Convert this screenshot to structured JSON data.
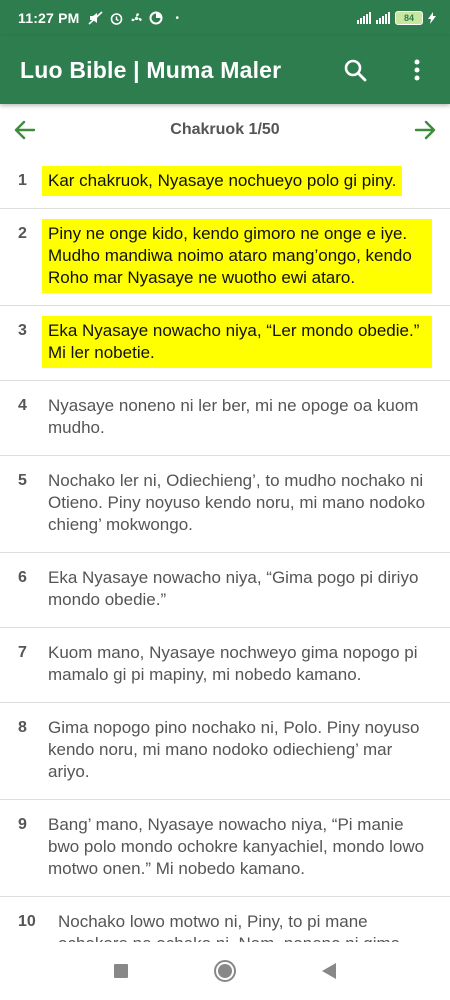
{
  "status_bar": {
    "time": "11:27 PM",
    "battery": "84"
  },
  "app_bar": {
    "title": "Luo Bible | Muma Maler",
    "search_icon": "search-icon",
    "menu_icon": "more-vert-icon",
    "color": "#2e7d4f"
  },
  "chapter_nav": {
    "title": "Chakruok 1/50",
    "prev_icon": "arrow-left-icon",
    "next_icon": "arrow-right-icon"
  },
  "highlight_color": "#ffff00",
  "verses": [
    {
      "num": "1",
      "text": "Kar chakruok, Nyasaye nochueyo polo gi piny.",
      "highlighted": true
    },
    {
      "num": "2",
      "text": "Piny ne onge kido, kendo gimoro ne onge e iye. Mudho mandiwa noimo ataro mang’ongo, kendo Roho mar Nyasaye ne wuotho ewi ataro.",
      "highlighted": true
    },
    {
      "num": "3",
      "text": "Eka Nyasaye nowacho niya, “Ler mondo obedie.” Mi ler nobetie.",
      "highlighted": true
    },
    {
      "num": "4",
      "text": "Nyasaye noneno ni ler ber, mi ne opoge oa kuom mudho.",
      "highlighted": false
    },
    {
      "num": "5",
      "text": "Nochako ler ni, Odiechieng’, to mudho nochako ni Otieno. Piny noyuso kendo noru, mi mano nodoko chieng’ mokwongo.",
      "highlighted": false
    },
    {
      "num": "6",
      "text": "Eka Nyasaye nowacho niya, “Gima pogo pi diriyo mondo obedie.”",
      "highlighted": false
    },
    {
      "num": "7",
      "text": "Kuom mano, Nyasaye nochweyo gima nopogo pi mamalo gi pi mapiny, mi nobedo kamano.",
      "highlighted": false
    },
    {
      "num": "8",
      "text": "Gima nopogo pino nochako ni, Polo. Piny noyuso kendo noru, mi mano nodoko odiechieng’ mar ariyo.",
      "highlighted": false
    },
    {
      "num": "9",
      "text": "Bang’ mano, Nyasaye nowacho niya, “Pi manie bwo polo mondo ochokre kanyachiel, mondo lowo motwo onen.” Mi nobedo kamano.",
      "highlighted": false
    },
    {
      "num": "10",
      "text": "Nochako lowo motwo ni, Piny, to pi mane ochokore ne ochako ni, Nam, noneno ni gima",
      "highlighted": false
    }
  ],
  "system_nav": {
    "recents_icon": "square-recents-icon",
    "home_icon": "circle-home-icon",
    "back_icon": "triangle-back-icon"
  }
}
